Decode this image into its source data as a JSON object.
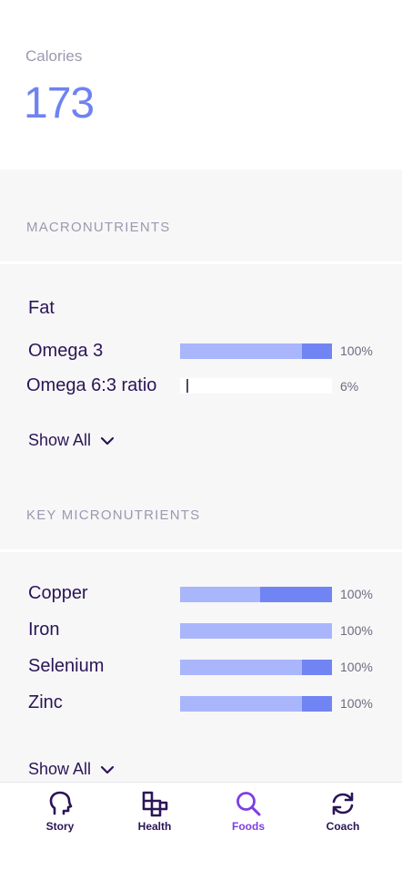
{
  "calories": {
    "label": "Calories",
    "value": "173"
  },
  "macronutrients": {
    "header": "MACRONUTRIENTS",
    "group_title": "Fat",
    "items": [
      {
        "label": "Omega 3",
        "percent": "100%",
        "fill_fraction": 1.0
      },
      {
        "label": "Omega 6:3 ratio",
        "percent": "6%",
        "fill_fraction": 0.06
      }
    ],
    "show_all": "Show All"
  },
  "micronutrients": {
    "header": "KEY MICRONUTRIENTS",
    "items": [
      {
        "label": "Copper",
        "percent": "100%",
        "fill_fraction": 1.0
      },
      {
        "label": "Iron",
        "percent": "100%",
        "fill_fraction": 1.0
      },
      {
        "label": "Selenium",
        "percent": "100%",
        "fill_fraction": 1.0
      },
      {
        "label": "Zinc",
        "percent": "100%",
        "fill_fraction": 1.0
      }
    ],
    "show_all": "Show All"
  },
  "tabs": [
    {
      "label": "Story",
      "icon": "head-icon",
      "active": false
    },
    {
      "label": "Health",
      "icon": "blocks-icon",
      "active": false
    },
    {
      "label": "Foods",
      "icon": "search-icon",
      "active": true
    },
    {
      "label": "Coach",
      "icon": "refresh-icon",
      "active": false
    }
  ],
  "colors": {
    "accent": "#7184f4",
    "accent_light": "#aab6fb",
    "text_dark": "#2b1556",
    "active_tab": "#7b3fe4",
    "muted": "#9a9ab0"
  }
}
